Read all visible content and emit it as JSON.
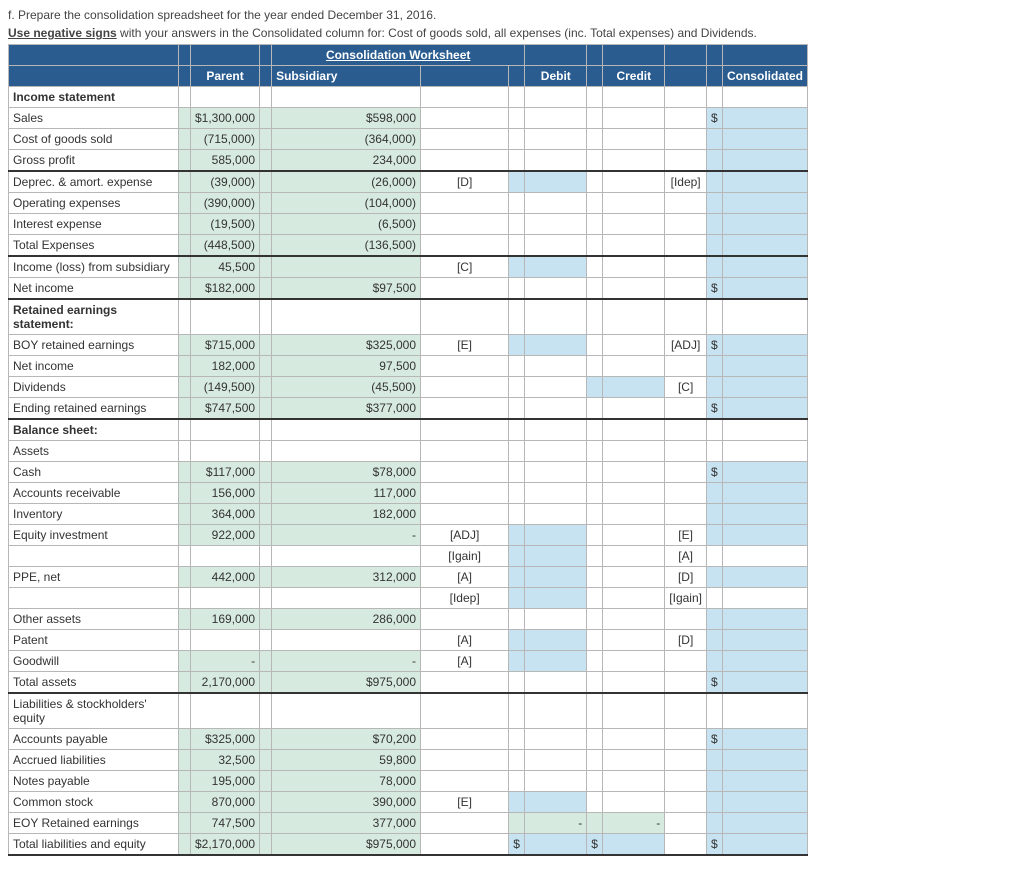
{
  "instructions": {
    "line1": "f. Prepare the consolidation spreadsheet for the year ended December 31, 2016.",
    "line2_prefix": "Use negative signs",
    "line2_rest": " with your answers in the Consolidated column for: Cost of goods sold, all expenses (inc. Total expenses) and Dividends."
  },
  "worksheet_title": "Consolidation Worksheet",
  "col_headers": {
    "parent": "Parent",
    "subsidiary": "Subsidiary",
    "debit": "Debit",
    "credit": "Credit",
    "consolidated": "Consolidated"
  },
  "sections": {
    "income_statement": "Income statement",
    "retained_earnings": "Retained earnings statement:",
    "balance_sheet": "Balance sheet:",
    "assets": "Assets",
    "liab_equity": "Liabilities & stockholders' equity"
  },
  "rows": {
    "sales": {
      "label": "Sales",
      "parent": "$1,300,000",
      "sub": "$598,000",
      "cons_s": "$"
    },
    "cogs": {
      "label": "Cost of goods sold",
      "parent": "(715,000)",
      "sub": "(364,000)"
    },
    "gross_profit": {
      "label": "Gross profit",
      "parent": "585,000",
      "sub": "234,000"
    },
    "dep": {
      "label": "Deprec. & amort. expense",
      "parent": "(39,000)",
      "sub": "(26,000)",
      "dref": "[D]",
      "cref": "[Idep]"
    },
    "opex": {
      "label": "Operating expenses",
      "parent": "(390,000)",
      "sub": "(104,000)"
    },
    "intexp": {
      "label": "Interest expense",
      "parent": "(19,500)",
      "sub": "(6,500)"
    },
    "totexp": {
      "label": "Total Expenses",
      "parent": "(448,500)",
      "sub": "(136,500)"
    },
    "incsub": {
      "label": "Income (loss) from subsidiary",
      "parent": "45,500",
      "dref": "[C]"
    },
    "netinc": {
      "label": "Net income",
      "parent": "$182,000",
      "sub": "$97,500",
      "cons_s": "$"
    },
    "boyre": {
      "label": "BOY retained earnings",
      "parent": "$715,000",
      "sub": "$325,000",
      "dref": "[E]",
      "cref": "[ADJ]",
      "cons_s": "$"
    },
    "netinc2": {
      "label": "Net income",
      "parent": "182,000",
      "sub": "97,500"
    },
    "div": {
      "label": "Dividends",
      "parent": "(149,500)",
      "sub": "(45,500)",
      "cref": "[C]"
    },
    "endre": {
      "label": "Ending retained earnings",
      "parent": "$747,500",
      "sub": "$377,000",
      "cons_s": "$"
    },
    "cash": {
      "label": "Cash",
      "parent": "$117,000",
      "sub": "$78,000",
      "cons_s": "$"
    },
    "ar": {
      "label": "Accounts receivable",
      "parent": "156,000",
      "sub": "117,000"
    },
    "inv": {
      "label": "Inventory",
      "parent": "364,000",
      "sub": "182,000"
    },
    "eqinv": {
      "label": "Equity investment",
      "parent": "922,000",
      "sub": "-",
      "dref": "[ADJ]",
      "cref": "[E]"
    },
    "eqinv2": {
      "dref": "[Igain]",
      "cref": "[A]"
    },
    "ppe": {
      "label": "PPE, net",
      "parent": "442,000",
      "sub": "312,000",
      "dref": "[A]",
      "cref": "[D]"
    },
    "ppe2": {
      "dref": "[Idep]",
      "cref": "[Igain]"
    },
    "other": {
      "label": "Other assets",
      "parent": "169,000",
      "sub": "286,000"
    },
    "patent": {
      "label": "Patent",
      "dref": "[A]",
      "cref": "[D]"
    },
    "goodwill": {
      "label": "Goodwill",
      "parent": "-",
      "sub": "-",
      "dref": "[A]"
    },
    "totassets": {
      "label": "Total assets",
      "parent": "2,170,000",
      "sub": "$975,000",
      "cons_s": "$"
    },
    "ap": {
      "label": "Accounts payable",
      "parent": "$325,000",
      "sub": "$70,200",
      "cons_s": "$"
    },
    "accr": {
      "label": "Accrued liabilities",
      "parent": "32,500",
      "sub": "59,800"
    },
    "np": {
      "label": "Notes payable",
      "parent": "195,000",
      "sub": "78,000"
    },
    "cs": {
      "label": "Common stock",
      "parent": "870,000",
      "sub": "390,000",
      "dref": "[E]"
    },
    "eoyre": {
      "label": "EOY Retained earnings",
      "parent": "747,500",
      "sub": "377,000",
      "debit": "-",
      "credit": "-"
    },
    "totle": {
      "label": "Total liabilities and equity",
      "parent": "$2,170,000",
      "sub": "$975,000",
      "debit_s": "$",
      "credit_s": "$",
      "cons_s": "$"
    }
  }
}
